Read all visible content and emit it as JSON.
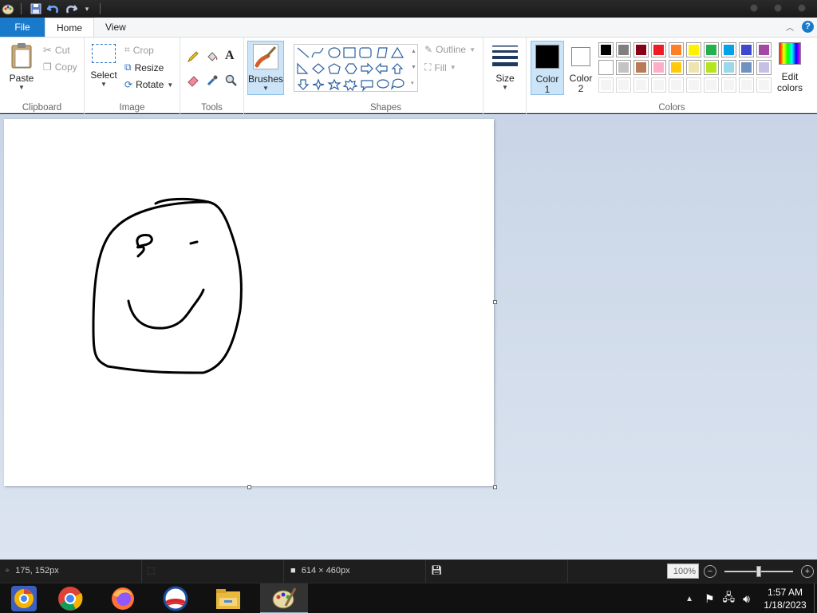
{
  "titlebar": {
    "quick_access": [
      "paint-app-icon",
      "save-icon",
      "undo-icon",
      "redo-icon",
      "customize-caret-icon"
    ]
  },
  "tabs": {
    "file": "File",
    "home": "Home",
    "view": "View",
    "help": "?"
  },
  "ribbon": {
    "clipboard": {
      "label": "Clipboard",
      "paste": "Paste",
      "cut": "Cut",
      "copy": "Copy"
    },
    "image": {
      "label": "Image",
      "select": "Select",
      "crop": "Crop",
      "resize": "Resize",
      "rotate": "Rotate"
    },
    "tools": {
      "label": "Tools",
      "text_tool_glyph": "A"
    },
    "brushes": {
      "label": "Brushes"
    },
    "shapes": {
      "label": "Shapes",
      "outline": "Outline",
      "fill": "Fill"
    },
    "size": {
      "label": "Size"
    },
    "colors": {
      "label": "Colors",
      "color1": "Color",
      "color1_num": "1",
      "color2": "Color",
      "color2_num": "2",
      "edit": "Edit",
      "edit2": "colors",
      "color1_value": "#000000",
      "color2_value": "#ffffff",
      "row1": [
        "#000000",
        "#7f7f7f",
        "#880015",
        "#ed1c24",
        "#ff7f27",
        "#fff200",
        "#22b14c",
        "#00a2e8",
        "#3f48cc",
        "#a349a4"
      ],
      "row2": [
        "#ffffff",
        "#c3c3c3",
        "#b97a57",
        "#ffaec9",
        "#ffc90e",
        "#efe4b0",
        "#b5e61d",
        "#99d9ea",
        "#7092be",
        "#c8bfe7"
      ],
      "row3": [
        "#f4f4f4",
        "#f4f4f4",
        "#f4f4f4",
        "#f4f4f4",
        "#f4f4f4",
        "#f4f4f4",
        "#f4f4f4",
        "#f4f4f4",
        "#f4f4f4",
        "#f4f4f4"
      ]
    }
  },
  "status": {
    "cursor_pos": "175, 152px",
    "canvas_size": "614 × 460px",
    "zoom": "100%",
    "zoom_fraction": 0.5
  },
  "taskbar": {
    "apps": [
      "chrome-canary-icon",
      "chrome-icon",
      "firefox-icon",
      "obama-logo-icon",
      "file-explorer-icon",
      "paint-icon"
    ],
    "time": "1:57 AM",
    "date": "1/18/2023"
  }
}
